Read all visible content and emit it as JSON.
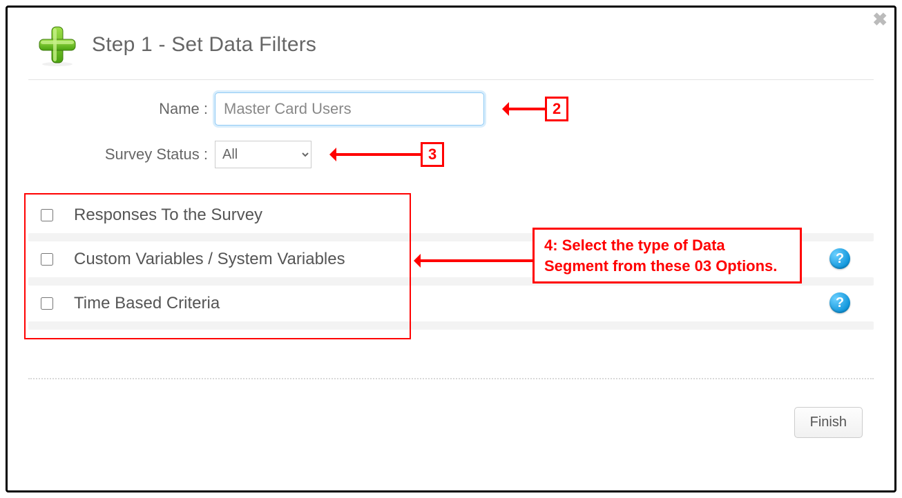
{
  "header": {
    "title": "Step 1 - Set Data Filters"
  },
  "form": {
    "name_label": "Name :",
    "name_value": "Master Card Users",
    "status_label": "Survey Status :",
    "status_selected": "All",
    "status_options": [
      "All"
    ]
  },
  "options": [
    {
      "label": "Responses To the Survey",
      "help": false
    },
    {
      "label": "Custom Variables / System Variables",
      "help": true
    },
    {
      "label": "Time Based Criteria",
      "help": true
    }
  ],
  "annotations": {
    "callout2": "2",
    "callout3": "3",
    "callout4": "4: Select the type of Data Segment from these 03 Options."
  },
  "footer": {
    "finish_label": "Finish"
  },
  "icons": {
    "help_glyph": "?"
  }
}
